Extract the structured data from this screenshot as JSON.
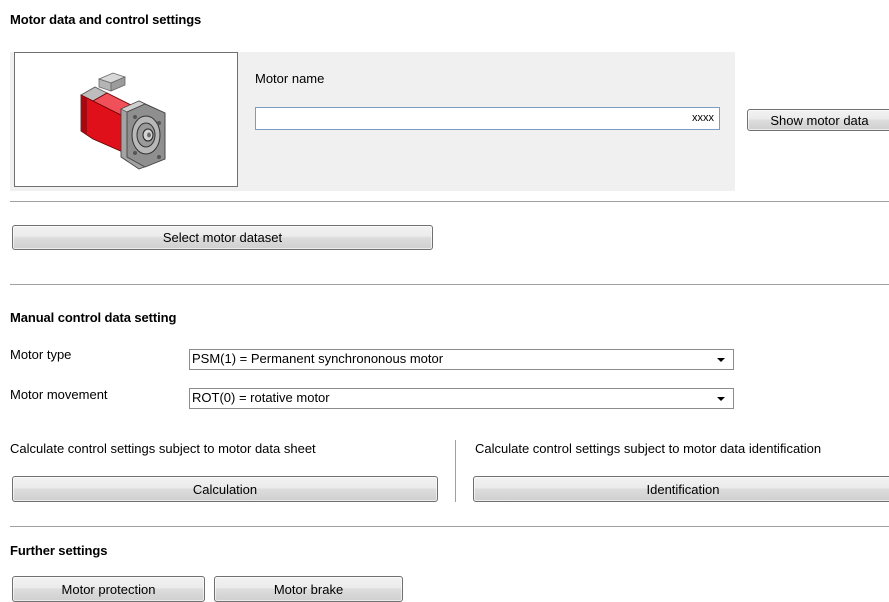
{
  "sections": {
    "motor_data_heading": "Motor data and control settings",
    "manual_control_heading": "Manual control data setting",
    "further_settings_heading": "Further settings"
  },
  "motor": {
    "name_label": "Motor name",
    "name_value": "xxxx",
    "show_motor_data_label": "Show motor data",
    "image_icon": "servo-motor-icon",
    "image_colors": {
      "body": "#e0101a",
      "housing": "#9a9a9a",
      "flange": "#8a8a8a"
    }
  },
  "select_motor_dataset_label": "Select motor dataset",
  "manual": {
    "motor_type_label": "Motor type",
    "motor_type_value": "PSM(1) = Permanent synchrononous motor",
    "motor_movement_label": "Motor movement",
    "motor_movement_value": "ROT(0) = rotative motor",
    "calc_datasheet_label": "Calculate control settings subject to motor data sheet",
    "calc_identification_label": "Calculate control settings subject to motor data identification",
    "calculation_button": "Calculation",
    "identification_button": "Identification"
  },
  "further": {
    "motor_protection_button": "Motor protection",
    "motor_brake_button": "Motor brake"
  }
}
